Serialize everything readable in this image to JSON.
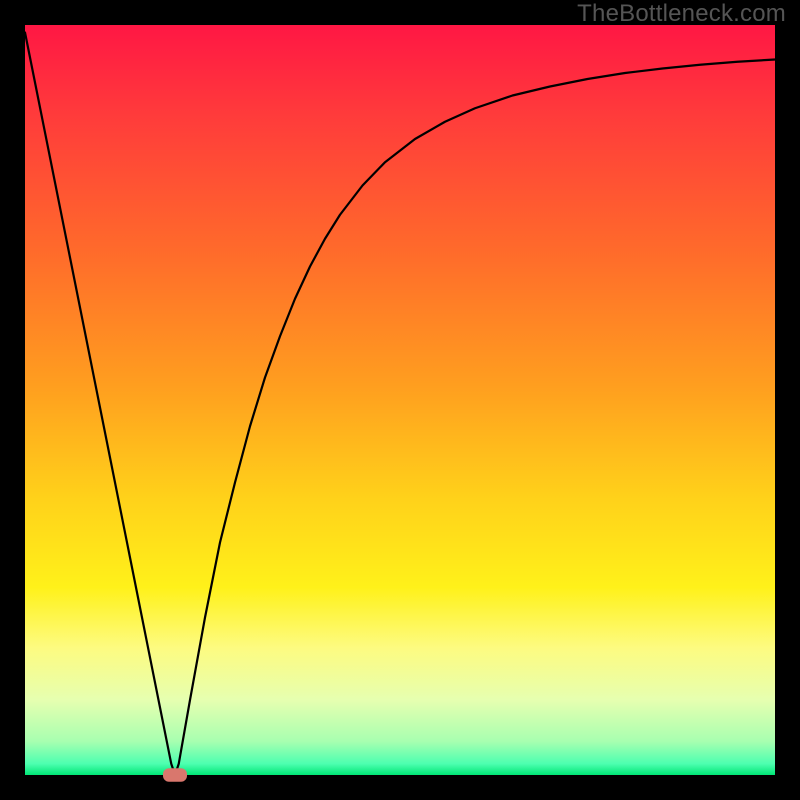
{
  "watermark": "TheBottleneck.com",
  "chart_data": {
    "type": "line",
    "title": "",
    "xlabel": "",
    "ylabel": "",
    "xlim": [
      0,
      100
    ],
    "ylim": [
      0,
      100
    ],
    "grid": false,
    "legend": false,
    "plot_background": {
      "gradient_stops": [
        {
          "offset": 0.0,
          "color": "#ff1744"
        },
        {
          "offset": 0.12,
          "color": "#ff3b3b"
        },
        {
          "offset": 0.3,
          "color": "#ff6a2b"
        },
        {
          "offset": 0.48,
          "color": "#ff9e1f"
        },
        {
          "offset": 0.63,
          "color": "#ffd11a"
        },
        {
          "offset": 0.75,
          "color": "#fff11a"
        },
        {
          "offset": 0.83,
          "color": "#fdfb80"
        },
        {
          "offset": 0.9,
          "color": "#e6ffb0"
        },
        {
          "offset": 0.955,
          "color": "#a8ffb0"
        },
        {
          "offset": 0.985,
          "color": "#4dffb0"
        },
        {
          "offset": 1.0,
          "color": "#00e676"
        }
      ]
    },
    "outer_border_px": 25,
    "series": [
      {
        "name": "bottleneck-curve",
        "x": [
          0.0,
          2.0,
          4.0,
          6.0,
          8.0,
          10.0,
          12.0,
          14.0,
          16.0,
          18.0,
          19.5,
          20.0,
          20.5,
          22.0,
          24.0,
          26.0,
          28.0,
          30.0,
          32.0,
          34.0,
          36.0,
          38.0,
          40.0,
          42.0,
          45.0,
          48.0,
          52.0,
          56.0,
          60.0,
          65.0,
          70.0,
          75.0,
          80.0,
          85.0,
          90.0,
          95.0,
          100.0
        ],
        "y": [
          99.0,
          89.0,
          79.0,
          69.0,
          59.0,
          49.0,
          39.0,
          29.0,
          19.0,
          9.0,
          1.5,
          0.0,
          1.5,
          10.0,
          21.0,
          31.0,
          39.0,
          46.5,
          53.0,
          58.5,
          63.5,
          67.8,
          71.5,
          74.7,
          78.6,
          81.7,
          84.8,
          87.1,
          88.9,
          90.6,
          91.8,
          92.8,
          93.6,
          94.2,
          94.7,
          95.1,
          95.4
        ]
      }
    ],
    "marker": {
      "name": "sweet-spot-marker",
      "x": 20.0,
      "y": 0.0,
      "width": 3.2,
      "height": 1.8,
      "color": "#d9776d"
    }
  }
}
